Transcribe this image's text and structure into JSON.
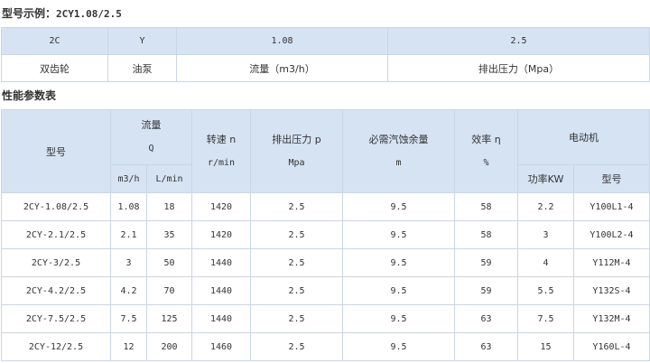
{
  "model_example": {
    "title": "型号示例：",
    "code": "2CY1.08/2.5",
    "codes": [
      "2C",
      "Y",
      "1.08",
      "2.5"
    ],
    "meanings": [
      "双齿轮",
      "油泵",
      "流量（m3/h）",
      "排出压力（Mpa）"
    ]
  },
  "perf": {
    "title": "性能参数表",
    "headers": {
      "model": "型号",
      "flow": "流量",
      "flow_q": "Q",
      "flow_m3h": "m3/h",
      "flow_lmin": "L/min",
      "speed": "转速 n",
      "speed_unit": "r/min",
      "pressure": "排出压力 p",
      "pressure_unit": "Mpa",
      "npsh": "必需汽蚀余量",
      "npsh_unit": "m",
      "eff": "效率 η",
      "eff_unit": "%",
      "motor": "电动机",
      "power": "功率KW",
      "motor_model": "型号"
    },
    "rows": [
      [
        "2CY-1.08/2.5",
        "1.08",
        "18",
        "1420",
        "2.5",
        "9.5",
        "58",
        "2.2",
        "Y100L1-4"
      ],
      [
        "2CY-2.1/2.5",
        "2.1",
        "35",
        "1420",
        "2.5",
        "9.5",
        "58",
        "3",
        "Y100L2-4"
      ],
      [
        "2CY-3/2.5",
        "3",
        "50",
        "1440",
        "2.5",
        "9.5",
        "59",
        "4",
        "Y112M-4"
      ],
      [
        "2CY-4.2/2.5",
        "4.2",
        "70",
        "1440",
        "2.5",
        "9.5",
        "59",
        "5.5",
        "Y132S-4"
      ],
      [
        "2CY-7.5/2.5",
        "7.5",
        "125",
        "1440",
        "2.5",
        "9.5",
        "63",
        "7.5",
        "Y132M-4"
      ],
      [
        "2CY-12/2.5",
        "12",
        "200",
        "1460",
        "2.5",
        "9.5",
        "63",
        "15",
        "Y160L-4"
      ]
    ]
  }
}
